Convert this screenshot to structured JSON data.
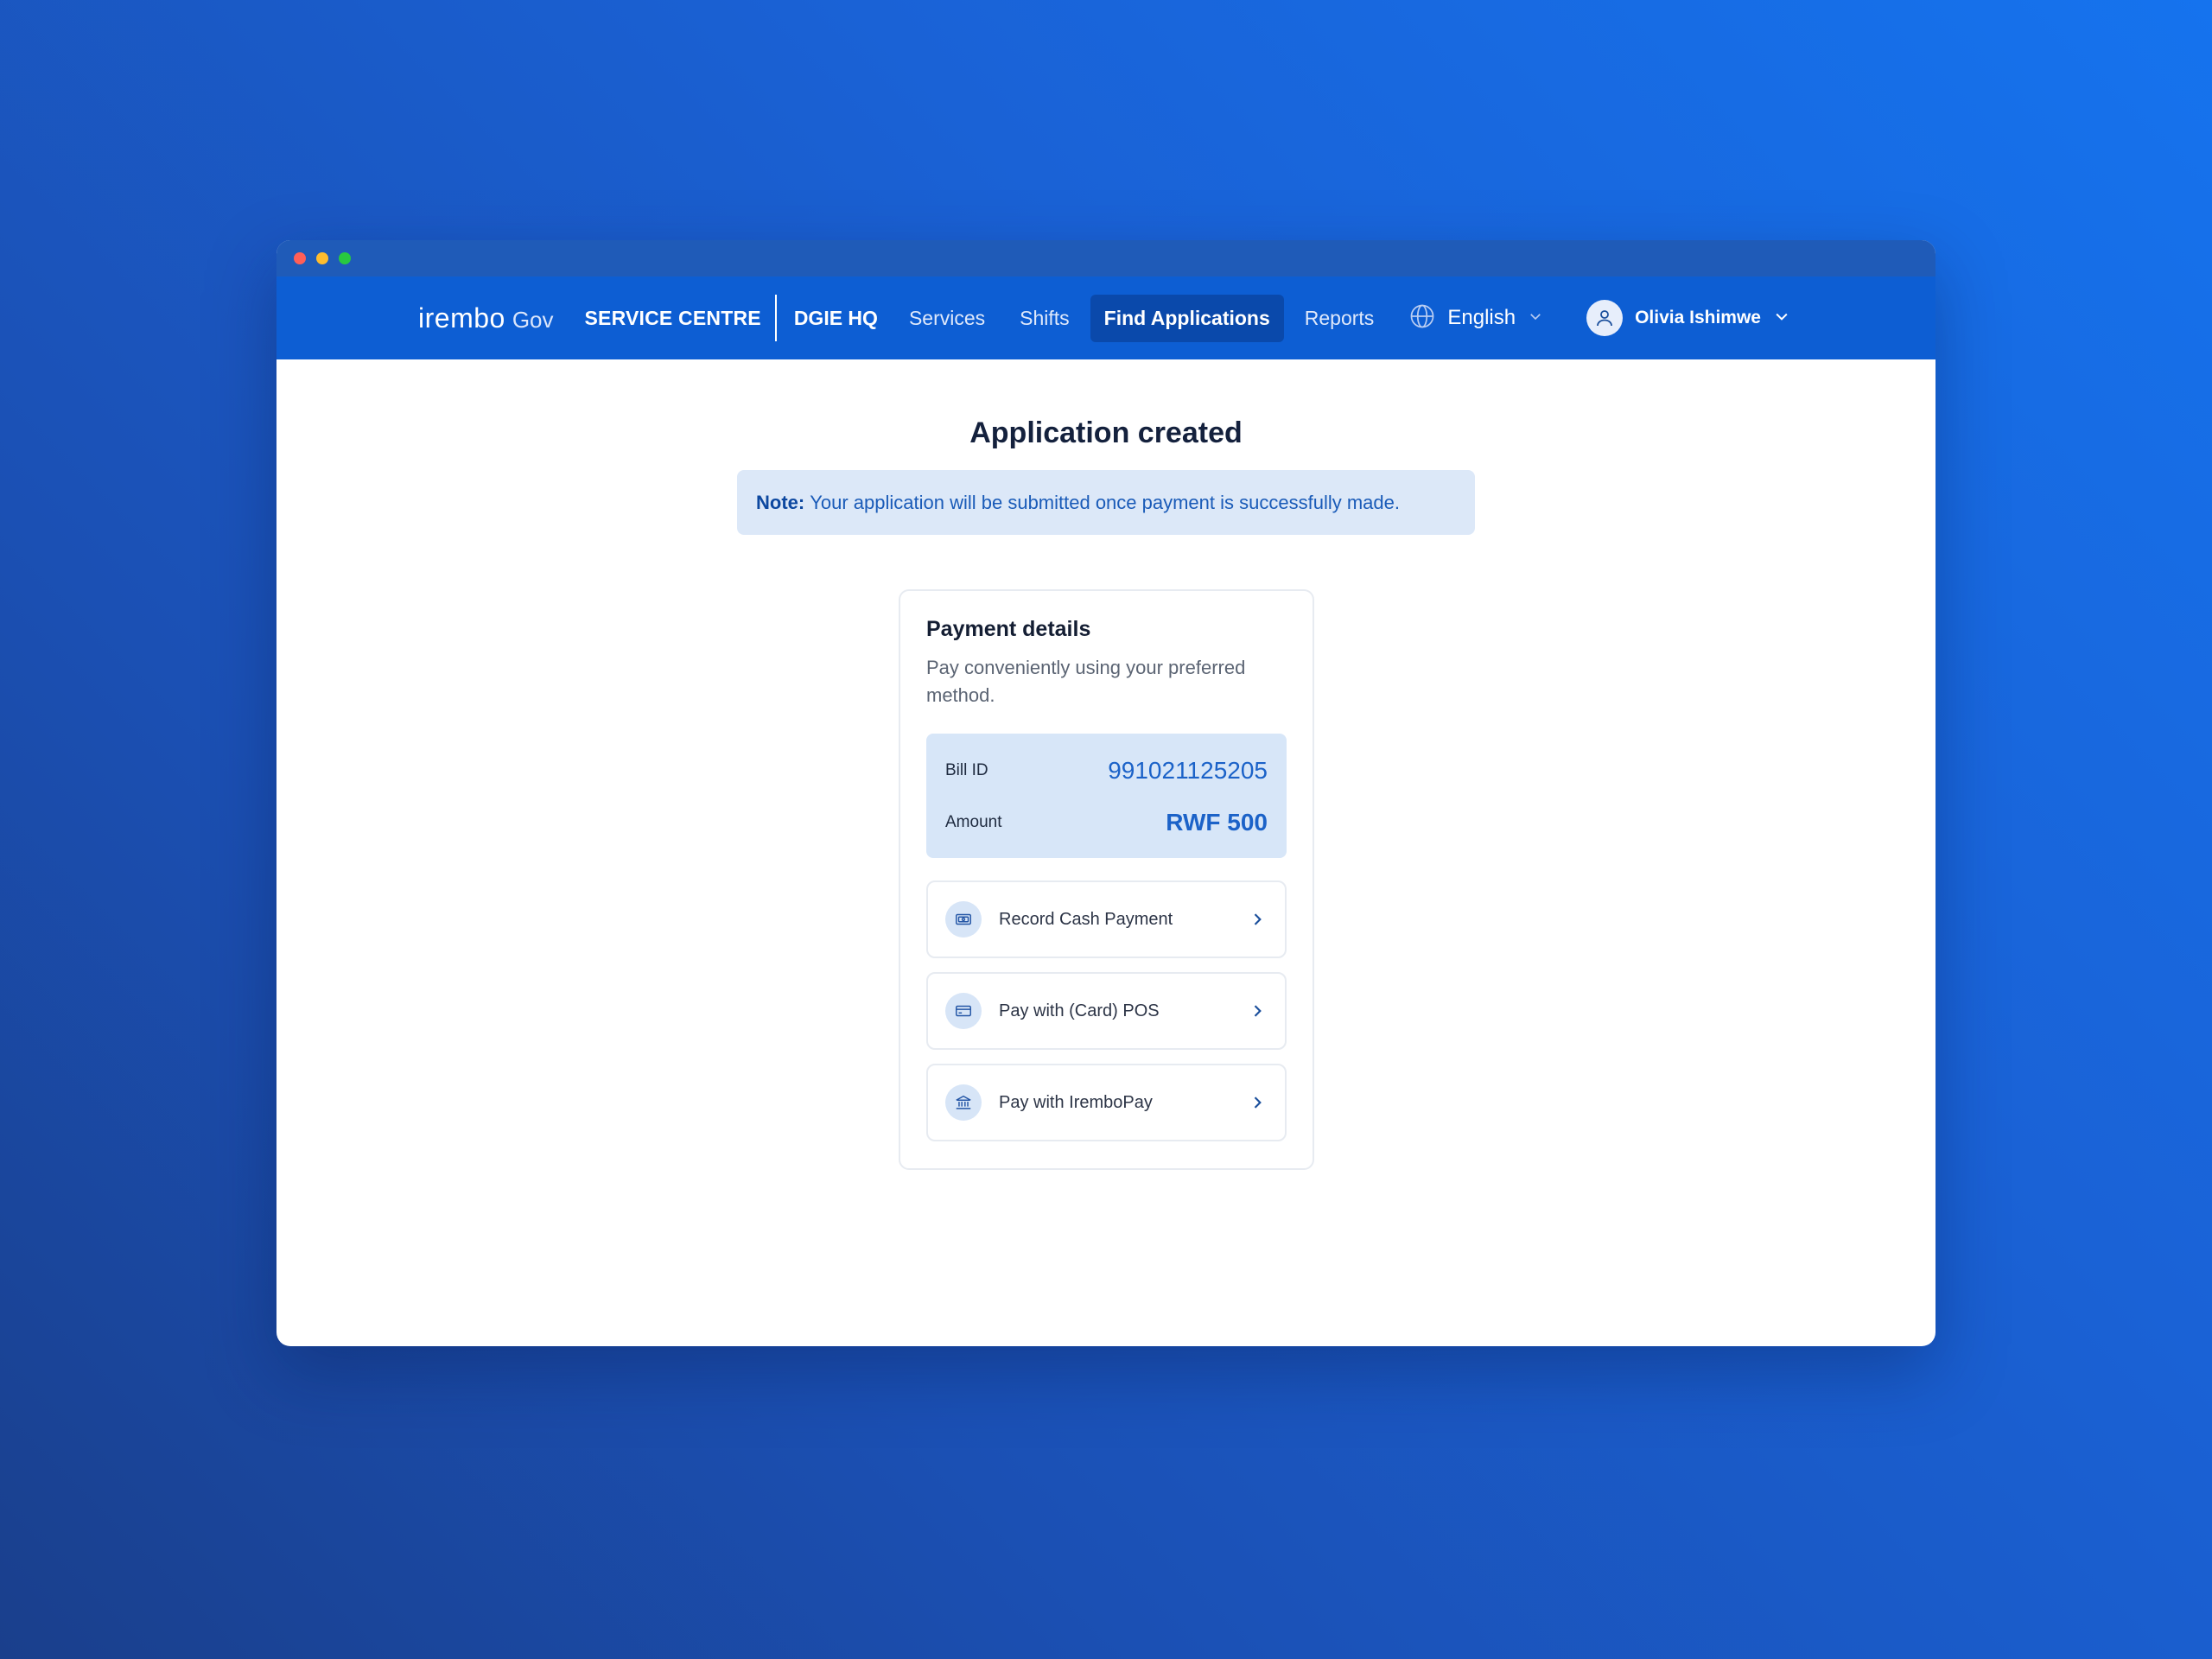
{
  "window": {
    "controls": [
      "close",
      "minimize",
      "maximize"
    ],
    "colors": {
      "close": "#ff5f57",
      "minimize": "#febc2e",
      "maximize": "#28c840"
    }
  },
  "navbar": {
    "logo_main": "irembo",
    "logo_sub": "Gov",
    "service_centre": "SERVICE CENTRE",
    "location": "DGIE HQ",
    "links": [
      "Services",
      "Shifts",
      "Find Applications",
      "Reports"
    ],
    "active_link": "Find Applications",
    "language": "English",
    "user_name": "Olivia Ishimwe",
    "colors": {
      "bar": "#0d5ed3",
      "active": "#0a49ab"
    }
  },
  "page": {
    "title": "Application created",
    "note_label": "Note:",
    "note_text": "Your application will be submitted once payment is successfully made."
  },
  "payment": {
    "title": "Payment details",
    "subtitle": "Pay conveniently using your preferred method.",
    "bill_id_label": "Bill ID",
    "bill_id_value": "991021125205",
    "amount_label": "Amount",
    "amount_value": "RWF 500",
    "methods": [
      {
        "label": "Record Cash Payment",
        "icon": "cash-icon"
      },
      {
        "label": "Pay with (Card) POS",
        "icon": "card-icon"
      },
      {
        "label": "Pay with IremboPay",
        "icon": "bank-icon"
      }
    ]
  }
}
